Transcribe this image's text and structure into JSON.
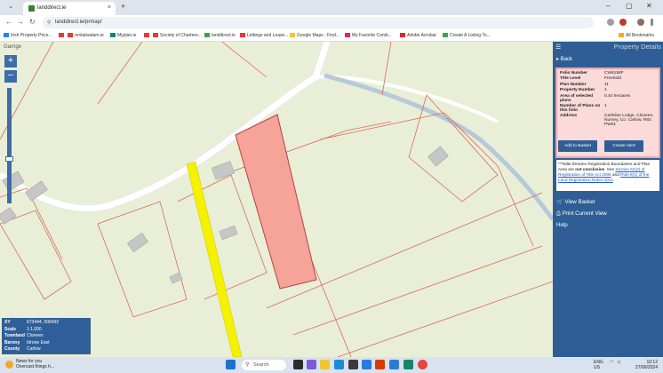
{
  "browser": {
    "tab_title": "landdirect.ie",
    "new_tab": "+",
    "tab_close": "×",
    "url": "landdirect.ie/prmap/",
    "window_controls": [
      "–",
      "▢",
      "✕"
    ],
    "bookmarks": [
      {
        "label": "Irish Property Price...",
        "color": "#1e88e5"
      },
      {
        "label": "",
        "color": "#e53935"
      },
      {
        "label": "rentalsadam.ie",
        "color": "#e53935"
      },
      {
        "label": "Myplan.ie",
        "color": "#00897b"
      },
      {
        "label": "",
        "color": "#e53935"
      },
      {
        "label": "Society of Chartere...",
        "color": "#e53935"
      },
      {
        "label": "landdirect.ie",
        "color": "#43a047"
      },
      {
        "label": "Lettings and Lease...",
        "color": "#e53935"
      },
      {
        "label": "Google Maps - Find...",
        "color": "#fbc02d"
      },
      {
        "label": "My Favorite Condi...",
        "color": "#e91e63"
      },
      {
        "label": "Adobe Acrobat",
        "color": "#d32f2f"
      },
      {
        "label": "Create A Listing To...",
        "color": "#43a047"
      },
      {
        "label": "All Bookmarks",
        "color": "#f9a825"
      }
    ]
  },
  "map": {
    "place_label": "Garrige",
    "zoom_in": "+",
    "zoom_out": "−",
    "info": [
      {
        "k": "XY",
        "v": "673444, 006492"
      },
      {
        "k": "Scale",
        "v": "1:1,000"
      },
      {
        "k": "Townland",
        "v": "Cloneen"
      },
      {
        "k": "Barony",
        "v": "Idrone East"
      },
      {
        "k": "County",
        "v": "Carlow"
      }
    ]
  },
  "panel": {
    "title": "Property Details",
    "toggle": "☰",
    "back": "Back",
    "details": [
      {
        "k": "Folio Number",
        "v": "CW6158F"
      },
      {
        "k": "Title Level",
        "v": "Freehold"
      },
      {
        "k": "Plan Number",
        "v": "11"
      },
      {
        "k": "Property Number",
        "v": "1"
      },
      {
        "k": "Area of selected plans",
        "v": "0.44 hectares"
      },
      {
        "k": "Number of Plans on this folio",
        "v": "1"
      },
      {
        "k": "Address",
        "v": "Carleline Lodge, Cloneen, Nurney, Co. Carlow, R93 PW01"
      }
    ],
    "add_basket": "Add to Basket",
    "create_alert": "Create Alert",
    "note_prefix": "**Tailte Éireann Registration Boundaries and Plan Area are ",
    "note_bold": "not conclusive",
    "note_mid": ". See ",
    "note_link1": "Section 62(2) of Registration of Title Act 2006",
    "note_and": " and ",
    "note_link2": "Rule 8(1) of the Land Registration Rules 2012",
    "note_end": ".",
    "view_basket": "View Basket",
    "print_view": "Print Current View",
    "help": "Help"
  },
  "taskbar": {
    "news_title": "News for you",
    "news_sub": "Overcast things h...",
    "search": "Search",
    "lang": "ENG",
    "region": "US",
    "time": "10:12",
    "date": "27/06/2024"
  }
}
